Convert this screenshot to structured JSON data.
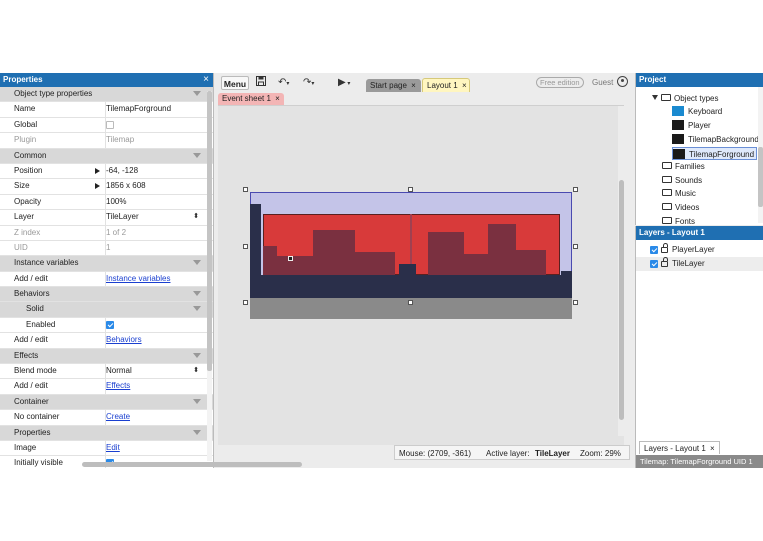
{
  "properties": {
    "title": "Properties",
    "close": "×",
    "rows": [
      {
        "type": "section",
        "label": "Object type properties"
      },
      {
        "type": "text",
        "label": "Name",
        "value": "TilemapForground"
      },
      {
        "type": "check",
        "label": "Global",
        "checked": false
      },
      {
        "type": "text",
        "label": "Plugin",
        "value": "Tilemap",
        "grey": true
      },
      {
        "type": "section",
        "label": "Common"
      },
      {
        "type": "text",
        "label": "Position",
        "value": "-64, -128",
        "expand": true
      },
      {
        "type": "text",
        "label": "Size",
        "value": "1856 x 608",
        "expand": true
      },
      {
        "type": "text",
        "label": "Opacity",
        "value": "100%"
      },
      {
        "type": "select",
        "label": "Layer",
        "value": "TileLayer"
      },
      {
        "type": "text",
        "label": "Z index",
        "value": "1 of 2",
        "grey": true
      },
      {
        "type": "text",
        "label": "UID",
        "value": "1",
        "grey": true
      },
      {
        "type": "section",
        "label": "Instance variables"
      },
      {
        "type": "link",
        "label": "Add / edit",
        "value": "Instance variables"
      },
      {
        "type": "section",
        "label": "Behaviors"
      },
      {
        "type": "subsection",
        "label": "Solid"
      },
      {
        "type": "check",
        "label": "Enabled",
        "checked": true,
        "sub": true
      },
      {
        "type": "link",
        "label": "Add / edit",
        "value": "Behaviors"
      },
      {
        "type": "section",
        "label": "Effects"
      },
      {
        "type": "select",
        "label": "Blend mode",
        "value": "Normal"
      },
      {
        "type": "link",
        "label": "Add / edit",
        "value": "Effects"
      },
      {
        "type": "section",
        "label": "Container"
      },
      {
        "type": "link",
        "label": "No container",
        "value": "Create"
      },
      {
        "type": "section",
        "label": "Properties"
      },
      {
        "type": "link",
        "label": "Image",
        "value": "Edit"
      },
      {
        "type": "check",
        "label": "Initially visible",
        "checked": true
      }
    ]
  },
  "toolbar": {
    "menu": "Menu",
    "save_icon": "save-icon",
    "undo_icon": "undo-icon",
    "redo_icon": "redo-icon",
    "play_icon": "play-icon",
    "edition": "Free edition",
    "guest": "Guest"
  },
  "tabs": {
    "start_page": "Start page",
    "layout": "Layout 1",
    "event_sheet": "Event sheet 1",
    "close": "×"
  },
  "statusbar": {
    "mouse": "Mouse: (2709, -361)",
    "active_layer_label": "Active layer:",
    "active_layer": "TileLayer",
    "zoom": "Zoom: 29%"
  },
  "project": {
    "title": "Project",
    "object_types": "Object types",
    "objects": [
      "Keyboard",
      "Player",
      "TilemapBackground",
      "TilemapForground"
    ],
    "folders": [
      "Families",
      "Sounds",
      "Music",
      "Videos",
      "Fonts"
    ]
  },
  "layers": {
    "title": "Layers - Layout 1",
    "items": [
      {
        "name": "PlayerLayer",
        "visible": true
      },
      {
        "name": "TileLayer",
        "visible": true
      }
    ],
    "tab": "Layers - Layout 1",
    "status": "Tilemap: TilemapForground UID 1"
  },
  "colors": {
    "accent": "#1f6fb2",
    "layout_bg": "#c4c4e8",
    "tile_red": "#d83a3a",
    "tile_dark": "#2a2f4a"
  }
}
